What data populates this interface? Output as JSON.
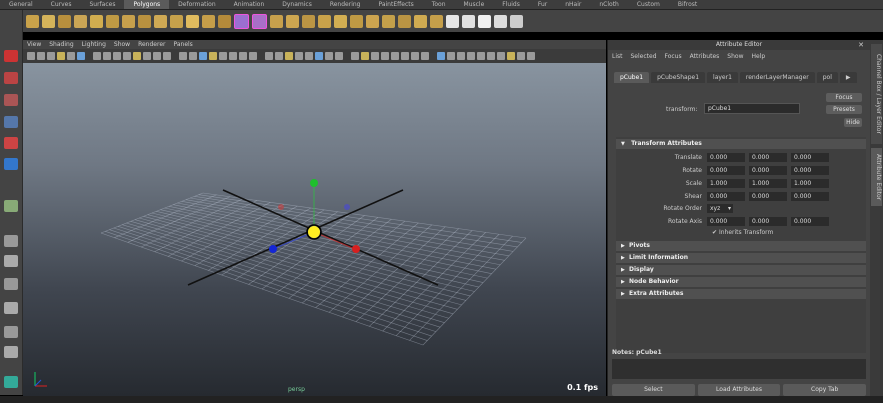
{
  "shelf": {
    "tabs": [
      "General",
      "Curves",
      "Surfaces",
      "Polygons",
      "Deformation",
      "Animation",
      "Dynamics",
      "Rendering",
      "PaintEffects",
      "Toon",
      "Muscle",
      "Fluids",
      "Fur",
      "nHair",
      "nCloth",
      "Custom",
      "Bifrost"
    ],
    "active_tab": "Polygons"
  },
  "viewport": {
    "menus": [
      "View",
      "Shading",
      "Lighting",
      "Show",
      "Renderer",
      "Panels"
    ],
    "fps": "0.1 fps",
    "camera": "persp"
  },
  "attribute_editor": {
    "title": "Attribute Editor",
    "menus": [
      "List",
      "Selected",
      "Focus",
      "Attributes",
      "Show",
      "Help"
    ],
    "node_tabs": [
      "pCube1",
      "pCubeShape1",
      "layer1",
      "renderLayerManager",
      "pol"
    ],
    "active_node_tab": "pCube1",
    "transform_label": "transform:",
    "transform_value": "pCube1",
    "focus_button": "Focus",
    "presets_button": "Presets",
    "hide_button": "Hide",
    "section_transform": "Transform Attributes",
    "rows": [
      {
        "label": "Translate",
        "values": [
          "0.000",
          "0.000",
          "0.000"
        ]
      },
      {
        "label": "Rotate",
        "values": [
          "0.000",
          "0.000",
          "0.000"
        ]
      },
      {
        "label": "Scale",
        "values": [
          "1.000",
          "1.000",
          "1.000"
        ]
      },
      {
        "label": "Shear",
        "values": [
          "0.000",
          "0.000",
          "0.000"
        ]
      }
    ],
    "rotate_order_label": "Rotate Order",
    "rotate_order_value": "xyz",
    "rotate_axis_label": "Rotate Axis",
    "rotate_axis_values": [
      "0.000",
      "0.000",
      "0.000"
    ],
    "inherits_transform": "Inherits Transform",
    "collapsed_sections": [
      "Pivots",
      "Limit Information",
      "Display",
      "Node Behavior",
      "Extra Attributes"
    ],
    "notes_label": "Notes:  pCube1",
    "bottom_buttons": [
      "Select",
      "Load Attributes",
      "Copy Tab"
    ]
  },
  "side_tabs": [
    "Channel Box / Layer Editor",
    "Attribute Editor"
  ]
}
